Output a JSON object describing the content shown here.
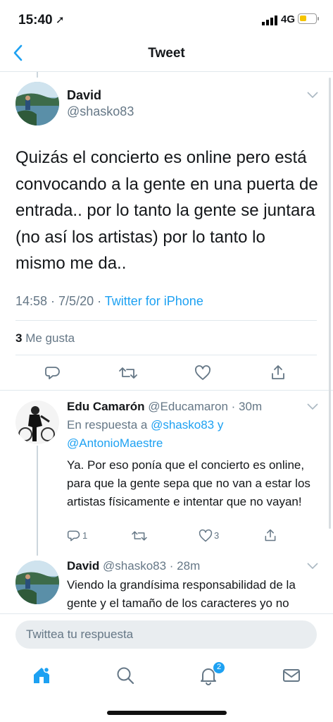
{
  "status_bar": {
    "time": "15:40",
    "network": "4G"
  },
  "nav": {
    "title": "Tweet"
  },
  "tweet": {
    "name": "David",
    "handle": "@shasko83",
    "text": "Quizás el concierto es online pero está convocando a la gente en una puerta de entrada.. por lo tanto la gente se juntara (no así los artistas) por lo tanto lo mismo me da..",
    "timestamp": "14:58 · 7/5/20 · ",
    "source": "Twitter for iPhone",
    "likes_count": "3",
    "likes_label": "Me gusta"
  },
  "replies": [
    {
      "name": "Edu Camarón",
      "handle": "@Educamaron",
      "time": " · 30m",
      "reply_prefix": "En respuesta a ",
      "reply_to_1": "@shasko83",
      "reply_and": " y",
      "reply_to_2": "@AntonioMaestre",
      "text": "Ya. Por eso ponía que el concierto es online, para que la gente sepa que no van a estar los artistas físicamente e intentar que no vayan!",
      "reply_count": "1",
      "like_count": "3"
    },
    {
      "name": "David",
      "handle": "@shasko83",
      "time": " · 28m",
      "text": "Viendo la grandísima responsabilidad de la gente y el tamaño de los caracteres yo no"
    }
  ],
  "compose": {
    "placeholder": "Twittea tu respuesta"
  },
  "tabbar": {
    "notifications_badge": "2"
  },
  "colors": {
    "accent": "#1da1f2",
    "secondary_text": "#657786",
    "divider": "#e1e8ed",
    "battery": "#f5c400"
  },
  "icons": [
    "location-arrow-icon",
    "signal-icon",
    "battery-icon",
    "back-chevron-icon",
    "chevron-down-icon",
    "reply-icon",
    "retweet-icon",
    "like-icon",
    "share-icon",
    "home-icon",
    "search-icon",
    "notifications-icon",
    "messages-icon"
  ]
}
